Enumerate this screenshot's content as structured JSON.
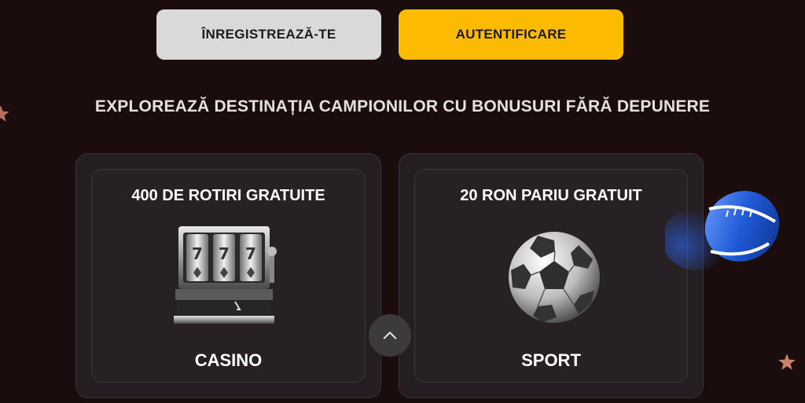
{
  "auth": {
    "register_label": "ÎNREGISTREAZĂ-TE",
    "login_label": "AUTENTIFICARE"
  },
  "headline": "EXPLOREAZĂ DESTINAȚIA CAMPIONILOR CU BONUSURI FĂRĂ DEPUNERE",
  "cards": [
    {
      "title": "400 DE ROTIRI GRATUITE",
      "category": "CASINO",
      "icon": "slot-machine-icon"
    },
    {
      "title": "20 RON PARIU GRATUIT",
      "category": "SPORT",
      "icon": "soccer-ball-icon"
    }
  ],
  "colors": {
    "background": "#1b0d0e",
    "register_button": "#d9d9d9",
    "login_button": "#fdbb00",
    "card_bg": "#241d21"
  },
  "icons": {
    "scroll_up": "chevron-up-icon",
    "decor": [
      "star-icon",
      "rugby-ball-icon",
      "star-icon"
    ]
  }
}
